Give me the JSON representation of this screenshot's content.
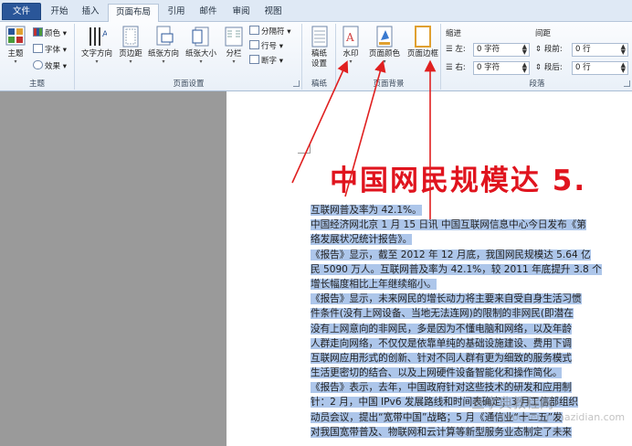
{
  "tabs": [
    {
      "label": "文件"
    },
    {
      "label": "开始"
    },
    {
      "label": "插入"
    },
    {
      "label": "页面布局"
    },
    {
      "label": "引用"
    },
    {
      "label": "邮件"
    },
    {
      "label": "审阅"
    },
    {
      "label": "视图"
    }
  ],
  "ribbon": {
    "theme_group": {
      "label": "主题",
      "theme_btn": "主题",
      "colors": "颜色",
      "fonts": "字体",
      "effects": "效果"
    },
    "page_setup_group": {
      "label": "页面设置",
      "text_direction": "文字方向",
      "margins": "页边距",
      "orientation": "纸张方向",
      "size": "纸张大小",
      "columns": "分栏",
      "breaks": "分隔符",
      "line_numbers": "行号",
      "hyphenation": "断字"
    },
    "manuscript_group": {
      "label": "稿纸",
      "btn_line1": "稿纸",
      "btn_line2": "设置"
    },
    "page_bg_group": {
      "label": "页面背景",
      "watermark": "水印",
      "page_color": "页面颜色",
      "page_borders": "页面边框"
    },
    "paragraph_group": {
      "label": "段落",
      "indent_header": "缩进",
      "spacing_header": "间距",
      "left_label": "左:",
      "left_value": "0 字符",
      "right_label": "右:",
      "right_value": "0 字符",
      "before_label": "段前:",
      "before_value": "0 行",
      "after_label": "段后:",
      "after_value": "0 行"
    }
  },
  "document": {
    "title": "中国网民规模达 5.",
    "lines": [
      {
        "text": "互联网普及率为 42.1%。",
        "selected": true
      },
      {
        "text": "中国经济网北京 1 月 15 日讯  中国互联网信息中心今日发布《第",
        "selected": true
      },
      {
        "text": "络发展状况统计报告》。",
        "selected": true
      },
      {
        "text": "《报告》显示，截至 2012 年 12 月底，我国网民规模达 5.64 亿",
        "selected": true
      },
      {
        "text": "民 5090 万人。互联网普及率为 42.1%，较 2011 年底提升 3.8 个",
        "selected": true
      },
      {
        "text": "增长幅度相比上年继续缩小。",
        "selected": true
      },
      {
        "text": "《报告》显示，未来网民的增长动力将主要来自受自身生活习惯",
        "selected": true
      },
      {
        "text": "件条件(没有上网设备、当地无法连网)的限制的非网民(即潜在",
        "selected": true
      },
      {
        "text": "没有上网意向的非网民，多是因为不懂电脑和网络，以及年龄",
        "selected": true
      },
      {
        "text": "人群走向网络，不仅仅是依靠单纯的基础设施建设、费用下调",
        "selected": true
      },
      {
        "text": "互联网应用形式的创新、针对不同人群有更为细致的服务模式",
        "selected": true
      },
      {
        "text": "生活更密切的结合、以及上网硬件设备智能化和操作简化。",
        "selected": true
      },
      {
        "text": "《报告》表示，去年，中国政府针对这些技术的研发和应用制",
        "selected": true
      },
      {
        "text": "针：2 月，中国 IPv6 发展路线和时间表确定；3 月工信部组织",
        "selected": true
      },
      {
        "text": "动员会议，提出“宽带中国”战略；5 月《通信业“十二五”发",
        "selected": true
      },
      {
        "text": "对我国宽带普及、物联网和云计算等新型服务业态制定了未来",
        "selected": true
      }
    ]
  },
  "watermark": {
    "line1": "查字典教程网",
    "line2": "jiaocheng.chazidian.com"
  },
  "colors": {
    "accent_red": "#e0141e",
    "selection": "#adc6ea",
    "file_tab": "#2a5699",
    "arrow_red": "#e02020"
  }
}
